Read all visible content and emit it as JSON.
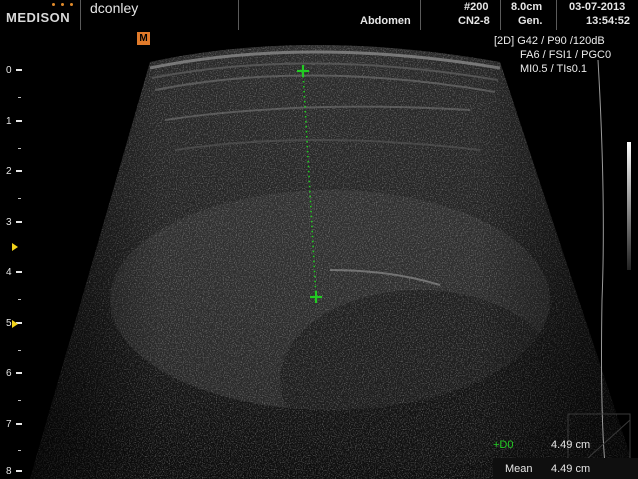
{
  "header": {
    "brand": "MEDISON",
    "patient": "dconley",
    "preset": "Abdomen",
    "frame": "#200",
    "probe": "CN2-8",
    "depth": "8.0cm",
    "freq": "Gen.",
    "date": "03-07-2013",
    "time": "13:54:52"
  },
  "orientation_marker": "M",
  "params": {
    "line1": "[2D] G42 / P90 /120dB",
    "line2": "FA6 / FSI1 / PGC0",
    "line3": "MI0.5 / TIs0.1"
  },
  "depth_scale": [
    "0",
    "1",
    "2",
    "3",
    "4",
    "5",
    "6",
    "7",
    "8"
  ],
  "measurement": {
    "d0_label": "+D0",
    "d0_value": "4.49 cm",
    "mean_label": "Mean",
    "mean_value": "4.49 cm",
    "color": "#22cc22"
  },
  "colors": {
    "logo_dots": "#e08a2a",
    "focus_marker": "#f1d21a",
    "m_marker": "#e07a2a"
  }
}
